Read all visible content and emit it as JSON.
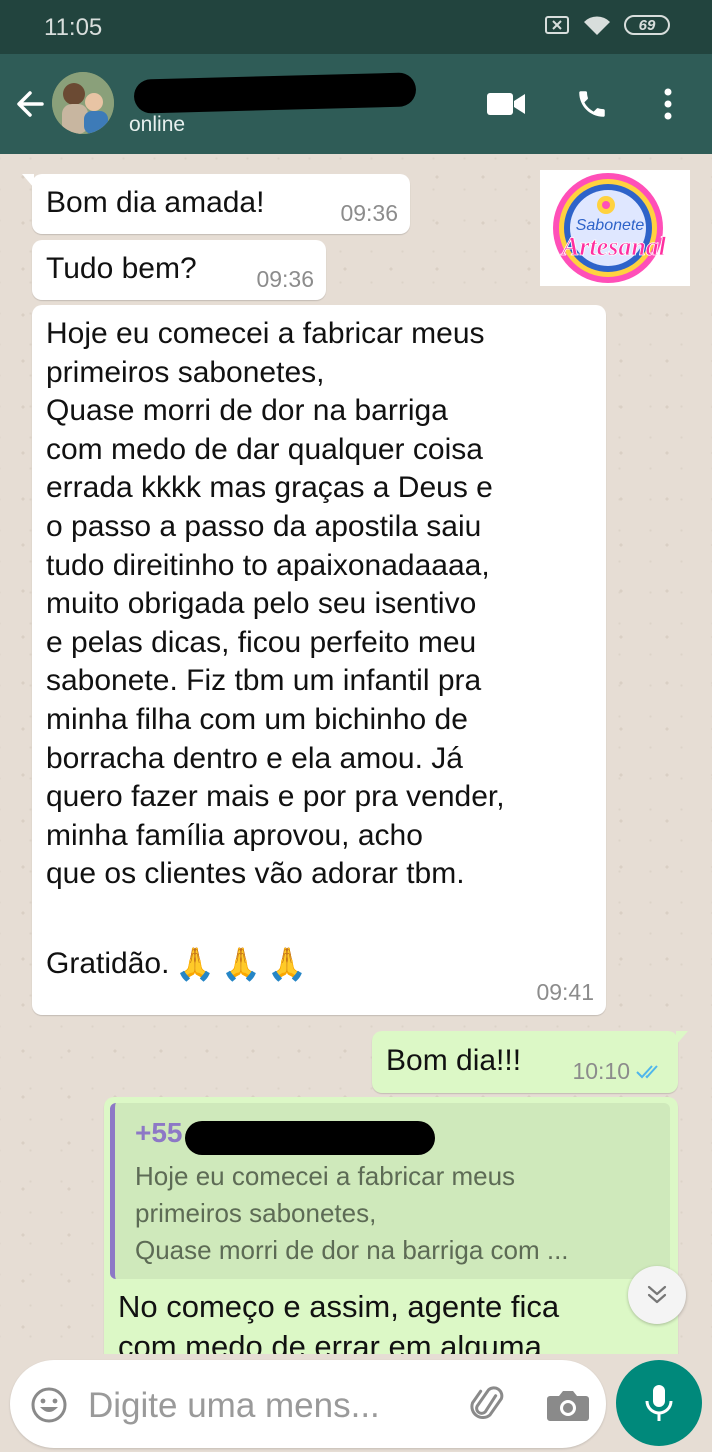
{
  "status_bar": {
    "time": "11:05",
    "battery": "69"
  },
  "header": {
    "status": "online"
  },
  "messages": [
    {
      "text": "Bom dia amada!",
      "time": "09:36"
    },
    {
      "text": "Tudo bem?",
      "time": "09:36"
    },
    {
      "lines": [
        "Hoje eu comecei a fabricar meus",
        "primeiros sabonetes,",
        "Quase morri de dor na barriga",
        "com medo de dar qualquer coisa",
        "errada kkkk mas graças a Deus e",
        "o passo a passo da apostila saiu",
        "tudo direitinho to apaixonadaaaa,",
        " muito obrigada pelo seu isentivo",
        "e pelas dicas, ficou perfeito meu",
        "sabonete. Fiz tbm um infantil pra",
        "minha filha com um bichinho de",
        "borracha dentro e ela amou. Já",
        "quero fazer mais e por pra vender,",
        "minha família aprovou, acho",
        "que os clientes vão adorar tbm."
      ],
      "last_line": "Gratidão.",
      "emoji": "🙏🙏🙏",
      "time": "09:41"
    },
    {
      "text": "Bom dia!!!",
      "time": "10:10"
    },
    {
      "quote_author": "+55",
      "quote_lines": [
        "Hoje eu comecei a fabricar meus",
        "primeiros sabonetes,",
        "Quase morri de dor na barriga com ..."
      ],
      "reply_lines": [
        "No começo e assim, agente fica",
        "com medo de errar em alguma"
      ]
    }
  ],
  "sticker": {
    "line1": "Sabonete",
    "line2": "Artesanal"
  },
  "composer": {
    "placeholder": "Digite uma mens..."
  },
  "colors": {
    "header": "#2f5c57",
    "status_bar": "#22443e",
    "outgoing_bubble": "#dcf8c6",
    "incoming_bubble": "#ffffff",
    "read_ticks": "#4fb6ec",
    "mic_button": "#00897b"
  }
}
